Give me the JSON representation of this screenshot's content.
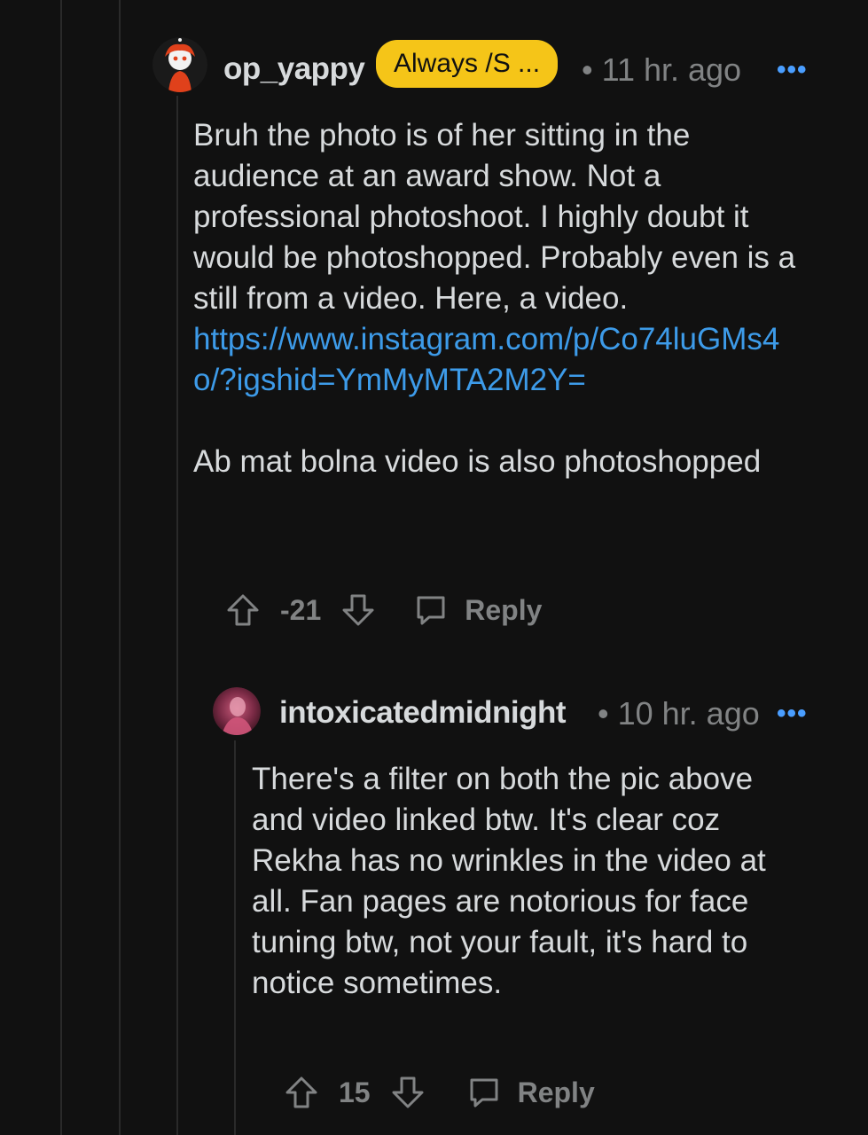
{
  "comment1": {
    "username": "op_yappy",
    "flair": "Always /S ...",
    "time": "• 11 hr. ago",
    "more": "•••",
    "paragraphs": [
      "Bruh the photo is of her sitting in the audience at an award show. Not a professional photoshoot. I highly doubt it would be photoshopped. Probably even is a still from a video. Here, a video."
    ],
    "link": "https://www.instagram.com/p/Co74luGMs4o/?igshid=YmMyMTA2M2Y=",
    "paragraph2": "Ab mat bolna video is also photoshopped",
    "score": "-21",
    "reply_label": "Reply"
  },
  "comment2": {
    "username": "intoxicatedmidnight",
    "time": "• 10 hr. ago",
    "more": "•••",
    "body": "There's a filter on both the pic above and video linked btw. It's clear coz Rekha has no wrinkles in the video at all. Fan pages are notorious for face tuning btw, not your fault, it's hard to notice sometimes.",
    "score": "15",
    "reply_label": "Reply"
  },
  "colors": {
    "background": "#111111",
    "flair": "#f5c518",
    "link": "#3d9be9",
    "meta": "#818384"
  }
}
